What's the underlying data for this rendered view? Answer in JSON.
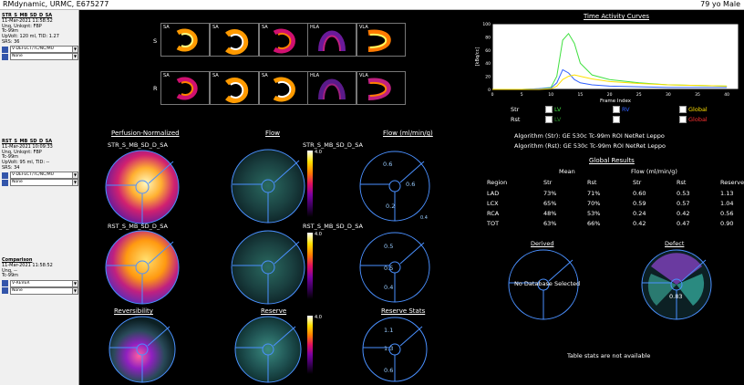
{
  "window": {
    "title": "RMdynamic, URMC, E675277",
    "patient": "79 yo  Male"
  },
  "sidebar": {
    "blocks": [
      {
        "name": "STR_S_MB_SD_D_SA",
        "lines": [
          "11-Mar-2021 11:58:52",
          "Unq, Unkqnt: FBP",
          "Tc-99m",
          "UpVolt: 120 ml, TID: 1.27",
          "SRS: 36"
        ],
        "select1": "V-DEFECT/TC/NC/MU",
        "select2": "None"
      },
      {
        "name": "RST_S_MB_SD_D_SA",
        "lines": [
          "11-Mar-2021 10:09:33",
          "Unq, Unkqnt: FBP",
          "Tc-99m",
          "UpVolt: 95 ml, TID: --",
          "SRS: 34"
        ],
        "select1": "V-DEFECT/TC/NC/MU",
        "select2": "None"
      },
      {
        "name": "Comparison",
        "lines": [
          "11-Mar-2021 11:58:52",
          "Unq, --",
          "Tc-99m"
        ],
        "select1": "V-REVER",
        "select2": "None"
      }
    ]
  },
  "slices": {
    "top_labels": [
      "SA",
      "SA",
      "SA",
      "HLA",
      "VLA"
    ],
    "row_labels": [
      "S",
      "R"
    ]
  },
  "headers": {
    "perfusion": "Perfusion-Normalized",
    "flow": "Flow",
    "flow_ml": "Flow (ml/min/g)",
    "str_name": "STR_S_MB_SD_D_SA",
    "rst_name": "RST_S_MB_SD_D_SA",
    "reversibility": "Reversibility",
    "reserve": "Reserve",
    "reserve_stats": "Reserve Stats"
  },
  "colorbar": {
    "max_flow": "4.0",
    "max_reserve": "4.0"
  },
  "polar_values": {
    "str": [
      "0.6",
      "0.6",
      "0.2"
    ],
    "str_corner": "0.4",
    "rst": [
      "0.5",
      "0.5",
      "0.4"
    ],
    "reserve": [
      "1.1",
      "1.3",
      "0.6"
    ]
  },
  "tac": {
    "title": "Time Activity Curves",
    "ylabel": "[kBq/cc]",
    "xlabel": "Frame Index",
    "xticks": [
      "0",
      "5",
      "10",
      "15",
      "20",
      "25",
      "30",
      "35",
      "40"
    ],
    "yticks": [
      "100",
      "80",
      "60",
      "40",
      "20",
      "0"
    ],
    "legend": {
      "str": "Str",
      "rst": "Rst",
      "items": [
        {
          "label": "LV",
          "color": "#40e040"
        },
        {
          "label": "RV",
          "color": "#3060ff"
        },
        {
          "label": "Global",
          "color": "#ffe000"
        }
      ],
      "rst_global": "Global",
      "rst_global_color": "#ff3030"
    }
  },
  "algorithm": {
    "str": "Algorithm (Str):  GE 530c Tc-99m ROI NetRet Leppo",
    "rst": "Algorithm (Rst):  GE 530c Tc-99m ROI NetRet Leppo"
  },
  "global": {
    "title": "Global Results",
    "mean": "Mean",
    "flow": "Flow (ml/min/g)",
    "columns": [
      "Region",
      "Str",
      "Rst",
      "Str",
      "Rst",
      "Reserve"
    ],
    "rows": [
      [
        "LAD",
        "73%",
        "71%",
        "0.60",
        "0.53",
        "1.13"
      ],
      [
        "LCX",
        "65%",
        "70%",
        "0.59",
        "0.57",
        "1.04"
      ],
      [
        "RCA",
        "48%",
        "53%",
        "0.24",
        "0.42",
        "0.56"
      ],
      [
        "TOT",
        "63%",
        "66%",
        "0.42",
        "0.47",
        "0.90"
      ]
    ]
  },
  "derived": {
    "title": "Derived",
    "message": "No Database Selected"
  },
  "defect": {
    "title": "Defect",
    "value": "0.83"
  },
  "table_stats": "Table stats are not available",
  "chart_data": {
    "type": "line",
    "title": "Time Activity Curves",
    "xlabel": "Frame Index",
    "ylabel": "[kBq/cc]",
    "xlim": [
      0,
      42
    ],
    "ylim": [
      0,
      100
    ],
    "x": [
      0,
      5,
      8,
      10,
      11,
      12,
      13,
      14,
      15,
      17,
      20,
      25,
      30,
      35,
      40
    ],
    "series": [
      {
        "name": "LV",
        "color": "#40e040",
        "values": [
          0,
          0,
          1,
          3,
          20,
          75,
          85,
          70,
          40,
          22,
          15,
          10,
          7,
          6,
          5
        ]
      },
      {
        "name": "RV",
        "color": "#3060ff",
        "values": [
          0,
          0,
          1,
          2,
          10,
          30,
          25,
          15,
          10,
          7,
          5,
          4,
          3,
          3,
          3
        ]
      },
      {
        "name": "Global",
        "color": "#ffe000",
        "values": [
          0,
          0,
          0,
          1,
          5,
          15,
          20,
          22,
          20,
          16,
          12,
          9,
          7,
          6,
          5
        ]
      }
    ]
  }
}
